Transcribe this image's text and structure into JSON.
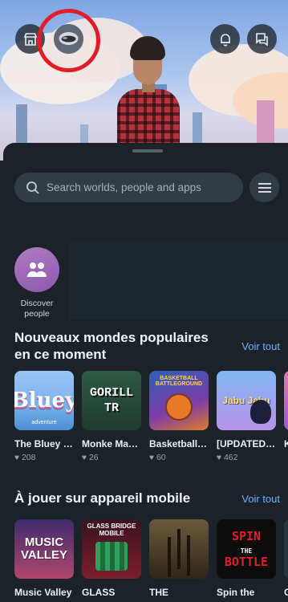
{
  "header": {
    "store_icon": "store-icon",
    "profile_icon": "profile-avatar-icon",
    "bell_icon": "bell-icon",
    "chat_icon": "chat-icon",
    "highlight_color": "#e21d26"
  },
  "search": {
    "placeholder": "Search worlds, people and apps",
    "icon": "search-icon",
    "menu_icon": "hamburger-menu-icon"
  },
  "discover": {
    "label": "Discover people",
    "icon": "people-icon",
    "accent": "#9a66b8"
  },
  "sections": [
    {
      "title": "Nouveaux mondes populaires en ce moment",
      "see_all": "Voir tout",
      "items": [
        {
          "title": "The Bluey Park 💙",
          "likes": "208",
          "thumb_text": "Bluey",
          "thumb_sub": "adventure"
        },
        {
          "title": "Monke Madness - ...",
          "likes": "26",
          "thumb_text": "GORILL TR"
        },
        {
          "title": "Basketball Battlegrou...",
          "likes": "60",
          "thumb_text": "BASKETBALL BATTLEGROUND"
        },
        {
          "title": "[UPDATED] Jabu Jabu:...",
          "likes": "462",
          "thumb_text": "Jabu Jabu"
        },
        {
          "title": "K",
          "likes": "",
          "thumb_text": ""
        }
      ]
    },
    {
      "title": "À jouer sur appareil mobile",
      "see_all": "Voir tout",
      "items": [
        {
          "title": "Music Valley",
          "thumb_text": "MUSIC VALLEY"
        },
        {
          "title": "GLASS",
          "thumb_text": "GLASS BRIDGE MOBILE"
        },
        {
          "title": "THE",
          "thumb_text": ""
        },
        {
          "title": "Spin the",
          "thumb_text_top": "SPIN",
          "thumb_text_mid": "THE",
          "thumb_text_bottom": "BOTTLE"
        },
        {
          "title": "C",
          "thumb_text": ""
        }
      ]
    }
  ]
}
